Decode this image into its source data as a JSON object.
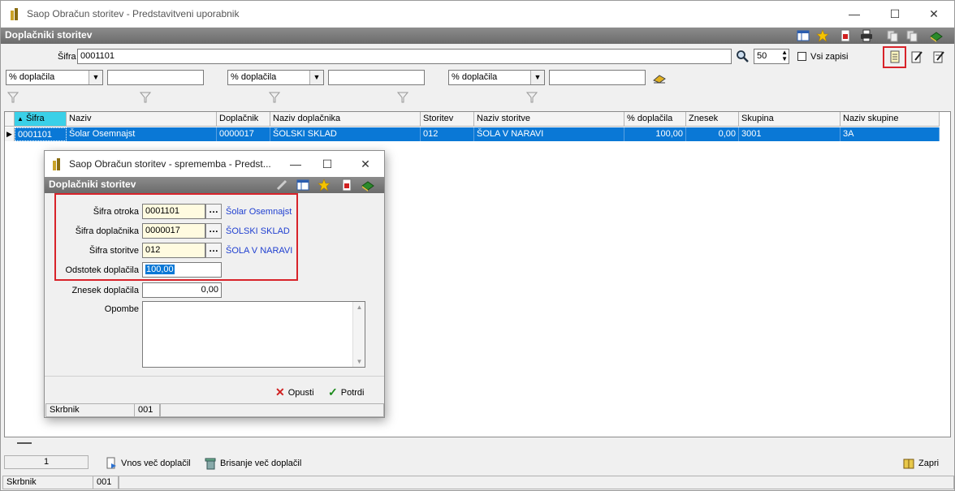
{
  "window": {
    "title": "Saop Obračun storitev - Predstavitveni uporabnik"
  },
  "header": {
    "title": "Doplačniki storitev"
  },
  "search": {
    "label": "Šifra",
    "value": "0001101",
    "count": "50",
    "all_records_label": "Vsi zapisi"
  },
  "filters": [
    {
      "combo": "% doplačila",
      "value": ""
    },
    {
      "combo": "% doplačila",
      "value": ""
    },
    {
      "combo": "% doplačila",
      "value": ""
    }
  ],
  "grid": {
    "columns": [
      "Šifra",
      "Naziv",
      "Doplačnik",
      "Naziv doplačnika",
      "Storitev",
      "Naziv storitve",
      "% doplačila",
      "Znesek",
      "Skupina",
      "Naziv skupine"
    ],
    "rows": [
      [
        "0001101",
        "Šolar Osemnajst",
        "0000017",
        "ŠOLSKI SKLAD",
        "012",
        "ŠOLA V NARAVI",
        "100,00",
        "0,00",
        "3001",
        "3A"
      ]
    ]
  },
  "bottom": {
    "record": "1",
    "bulk_entry": "Vnos več doplačil",
    "bulk_delete": "Brisanje več doplačil",
    "close": "Zapri"
  },
  "statusbar": {
    "label": "Skrbnik",
    "value": "001"
  },
  "dialog": {
    "title": "Saop Obračun storitev - sprememba - Predst...",
    "header": "Doplačniki storitev",
    "fields": {
      "child_label": "Šifra otroka",
      "child_value": "0001101",
      "child_name": "Šolar Osemnajst",
      "payer_label": "Šifra doplačnika",
      "payer_value": "0000017",
      "payer_name": "ŠOLSKI SKLAD",
      "service_label": "Šifra storitve",
      "service_value": "012",
      "service_name": "ŠOLA V NARAVI",
      "percent_label": "Odstotek doplačila",
      "percent_value": "100,00",
      "amount_label": "Znesek doplačila",
      "amount_value": "0,00",
      "notes_label": "Opombe",
      "notes_value": ""
    },
    "cancel": "Opusti",
    "confirm": "Potrdi",
    "status_label": "Skrbnik",
    "status_value": "001"
  },
  "colors": {
    "header": "#7a7a7a",
    "selection": "#0a78d6",
    "highlight": "#d8232a",
    "link": "#1f3fd0"
  }
}
